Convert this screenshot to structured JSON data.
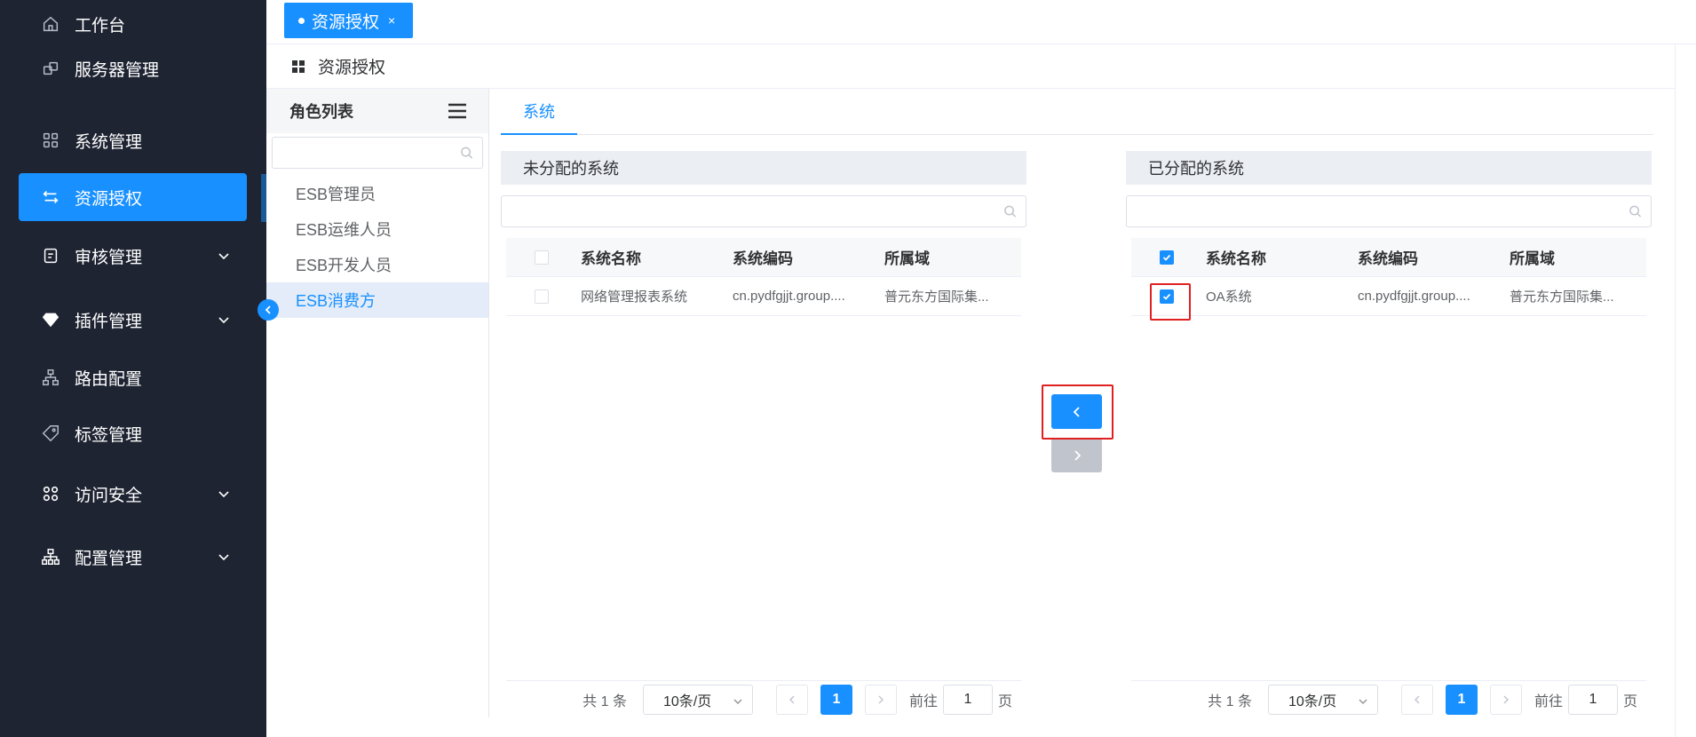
{
  "sidebar": {
    "items": [
      {
        "label": "工作台",
        "icon": "home-icon",
        "expandable": false,
        "active": false
      },
      {
        "label": "服务器管理",
        "icon": "server-icon",
        "expandable": false,
        "active": false
      },
      {
        "label": "系统管理",
        "icon": "apps-icon",
        "expandable": false,
        "active": false
      },
      {
        "label": "资源授权",
        "icon": "swap-icon",
        "expandable": false,
        "active": true
      },
      {
        "label": "审核管理",
        "icon": "audit-icon",
        "expandable": true,
        "active": false
      },
      {
        "label": "插件管理",
        "icon": "diamond-icon",
        "expandable": true,
        "active": false
      },
      {
        "label": "路由配置",
        "icon": "route-icon",
        "expandable": false,
        "active": false
      },
      {
        "label": "标签管理",
        "icon": "tag-icon",
        "expandable": false,
        "active": false
      },
      {
        "label": "访问安全",
        "icon": "security-icon",
        "expandable": true,
        "active": false
      },
      {
        "label": "配置管理",
        "icon": "org-icon",
        "expandable": true,
        "active": false
      }
    ]
  },
  "tags": {
    "active_label": "资源授权",
    "close_symbol": "×"
  },
  "breadcrumb": {
    "title": "资源授权"
  },
  "roles": {
    "header": "角色列表",
    "search_placeholder": "",
    "items": [
      "ESB管理员",
      "ESB运维人员",
      "ESB开发人员",
      "ESB消费方"
    ],
    "selected_index": 3
  },
  "tabs": {
    "active": "系统"
  },
  "unassigned": {
    "title": "未分配的系统",
    "columns": [
      "系统名称",
      "系统编码",
      "所属域"
    ],
    "rows": [
      {
        "name": "网络管理报表系统",
        "code": "cn.pydfgjjt.group....",
        "domain": "普元东方国际集...",
        "checked": false
      }
    ],
    "total_text": "共 1 条",
    "page_size": "10条/页",
    "current_page": "1",
    "goto_label": "前往",
    "goto_value": "1",
    "page_suffix": "页"
  },
  "assigned": {
    "title": "已分配的系统",
    "columns": [
      "系统名称",
      "系统编码",
      "所属域"
    ],
    "rows": [
      {
        "name": "OA系统",
        "code": "cn.pydfgjjt.group....",
        "domain": "普元东方国际集...",
        "checked": true
      }
    ],
    "total_text": "共 1 条",
    "page_size": "10条/页",
    "current_page": "1",
    "goto_label": "前往",
    "goto_value": "1",
    "page_suffix": "页"
  },
  "colors": {
    "accent": "#1890ff",
    "sidebar_bg": "#1f2433",
    "highlight": "#e02020",
    "disabled": "#c0c4cc"
  }
}
